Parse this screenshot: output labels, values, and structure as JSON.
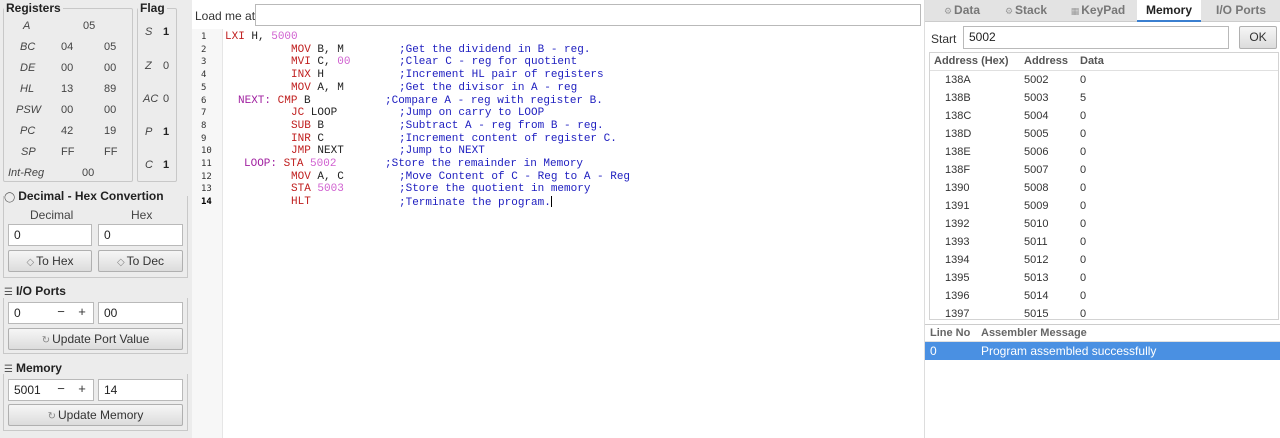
{
  "registers": {
    "title": "Registers",
    "rows": [
      {
        "name": "A",
        "v1": "05",
        "v2": ""
      },
      {
        "name": "BC",
        "v1": "04",
        "v2": "05"
      },
      {
        "name": "DE",
        "v1": "00",
        "v2": "00"
      },
      {
        "name": "HL",
        "v1": "13",
        "v2": "89"
      },
      {
        "name": "PSW",
        "v1": "00",
        "v2": "00"
      },
      {
        "name": "PC",
        "v1": "42",
        "v2": "19"
      },
      {
        "name": "SP",
        "v1": "FF",
        "v2": "FF"
      },
      {
        "name": "Int-Reg",
        "v1": "00",
        "v2": ""
      }
    ]
  },
  "flags": {
    "title": "Flag",
    "rows": [
      {
        "name": "S",
        "value": "1"
      },
      {
        "name": "Z",
        "value": "0"
      },
      {
        "name": "AC",
        "value": "0"
      },
      {
        "name": "P",
        "value": "1"
      },
      {
        "name": "C",
        "value": "1"
      }
    ]
  },
  "converter": {
    "title": "Decimal - Hex Convertion",
    "decimal_label": "Decimal",
    "hex_label": "Hex",
    "decimal_value": "0",
    "hex_value": "0",
    "to_hex_label": "To Hex",
    "to_dec_label": "To Dec"
  },
  "io_ports": {
    "title": "I/O Ports",
    "port": "0",
    "value": "00",
    "minus": "−",
    "plus": "+",
    "update_label": "Update Port Value"
  },
  "memory": {
    "title": "Memory",
    "address": "5001",
    "value": "14",
    "minus": "−",
    "plus": "+",
    "update_label": "Update Memory"
  },
  "editor": {
    "load_label": "Load me at",
    "load_value": "",
    "line_numbers": [
      "1",
      "2",
      "3",
      "4",
      "5",
      "6",
      "7",
      "8",
      "9",
      "10",
      "11",
      "12",
      "13",
      "14"
    ],
    "lines": [
      {
        "label": "",
        "mn": "LXI",
        "ops": " H, ",
        "num": "5000",
        "cmt": ""
      },
      {
        "label": "",
        "mn": "MOV",
        "ops": " B, M",
        "num": "",
        "cmt": ";Get the dividend in B - reg."
      },
      {
        "label": "",
        "mn": "MVI",
        "ops": " C, ",
        "num": "00",
        "cmt": ";Clear C - reg for quotient"
      },
      {
        "label": "",
        "mn": "INX",
        "ops": " H",
        "num": "",
        "cmt": ";Increment HL pair of registers"
      },
      {
        "label": "",
        "mn": "MOV",
        "ops": " A, M",
        "num": "",
        "cmt": ";Get the divisor in A - reg"
      },
      {
        "label": "NEXT:",
        "mn": "CMP",
        "ops": " B",
        "num": "",
        "cmt": ";Compare A - reg with register B."
      },
      {
        "label": "",
        "mn": "JC",
        "ops": " LOOP",
        "num": "",
        "cmt": ";Jump on carry to LOOP"
      },
      {
        "label": "",
        "mn": "SUB",
        "ops": " B",
        "num": "",
        "cmt": ";Subtract A - reg from B - reg."
      },
      {
        "label": "",
        "mn": "INR",
        "ops": " C",
        "num": "",
        "cmt": ";Increment content of register C."
      },
      {
        "label": "",
        "mn": "JMP",
        "ops": " NEXT",
        "num": "",
        "cmt": ";Jump to NEXT"
      },
      {
        "label": "LOOP:",
        "mn": "STA",
        "ops": " ",
        "num": "5002",
        "cmt": ";Store the remainder in Memory"
      },
      {
        "label": "",
        "mn": "MOV",
        "ops": " A, C",
        "num": "",
        "cmt": ";Move Content of C - Reg to A - Reg"
      },
      {
        "label": "",
        "mn": "STA",
        "ops": " ",
        "num": "5003",
        "cmt": ";Store the quotient in memory"
      },
      {
        "label": "",
        "mn": "HLT",
        "ops": "",
        "num": "",
        "cmt": ";Terminate the program."
      }
    ]
  },
  "tabs": [
    {
      "label": "Data",
      "icon": "gear-icon",
      "active": false
    },
    {
      "label": "Stack",
      "icon": "gear-icon",
      "active": false
    },
    {
      "label": "KeyPad",
      "icon": "keypad-icon",
      "active": false
    },
    {
      "label": "Memory",
      "icon": "",
      "active": true
    },
    {
      "label": "I/O Ports",
      "icon": "",
      "active": false
    }
  ],
  "memory_view": {
    "start_label": "Start",
    "start_value": "5002",
    "ok_label": "OK",
    "columns": [
      "Address (Hex)",
      "Address",
      "Data"
    ],
    "rows": [
      {
        "hex": "138A",
        "addr": "5002",
        "data": "0"
      },
      {
        "hex": "138B",
        "addr": "5003",
        "data": "5"
      },
      {
        "hex": "138C",
        "addr": "5004",
        "data": "0"
      },
      {
        "hex": "138D",
        "addr": "5005",
        "data": "0"
      },
      {
        "hex": "138E",
        "addr": "5006",
        "data": "0"
      },
      {
        "hex": "138F",
        "addr": "5007",
        "data": "0"
      },
      {
        "hex": "1390",
        "addr": "5008",
        "data": "0"
      },
      {
        "hex": "1391",
        "addr": "5009",
        "data": "0"
      },
      {
        "hex": "1392",
        "addr": "5010",
        "data": "0"
      },
      {
        "hex": "1393",
        "addr": "5011",
        "data": "0"
      },
      {
        "hex": "1394",
        "addr": "5012",
        "data": "0"
      },
      {
        "hex": "1395",
        "addr": "5013",
        "data": "0"
      },
      {
        "hex": "1396",
        "addr": "5014",
        "data": "0"
      },
      {
        "hex": "1397",
        "addr": "5015",
        "data": "0"
      }
    ]
  },
  "messages": {
    "columns": [
      "Line No",
      "Assembler Message"
    ],
    "rows": [
      {
        "line": "0",
        "message": "Program assembled successfully"
      }
    ]
  }
}
